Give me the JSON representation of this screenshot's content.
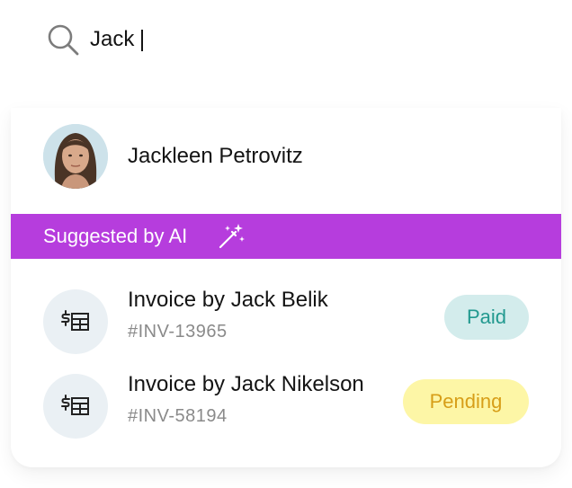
{
  "search": {
    "query": "Jack ",
    "icon": "search-icon"
  },
  "person": {
    "name": "Jackleen Petrovitz"
  },
  "ai_banner": {
    "label": "Suggested by AI",
    "icon": "magic-wand-icon",
    "color": "#b63ddd"
  },
  "invoices": [
    {
      "title": "Invoice by Jack Belik",
      "number": "#INV-13965",
      "status": "Paid",
      "status_color": "#22998f",
      "status_bg": "#d3ecec",
      "icon": "invoice-icon"
    },
    {
      "title": "Invoice by Jack Nikelson",
      "number": "#INV-58194",
      "status": "Pending",
      "status_color": "#d79e18",
      "status_bg": "#fdf6a6",
      "icon": "invoice-icon"
    }
  ]
}
